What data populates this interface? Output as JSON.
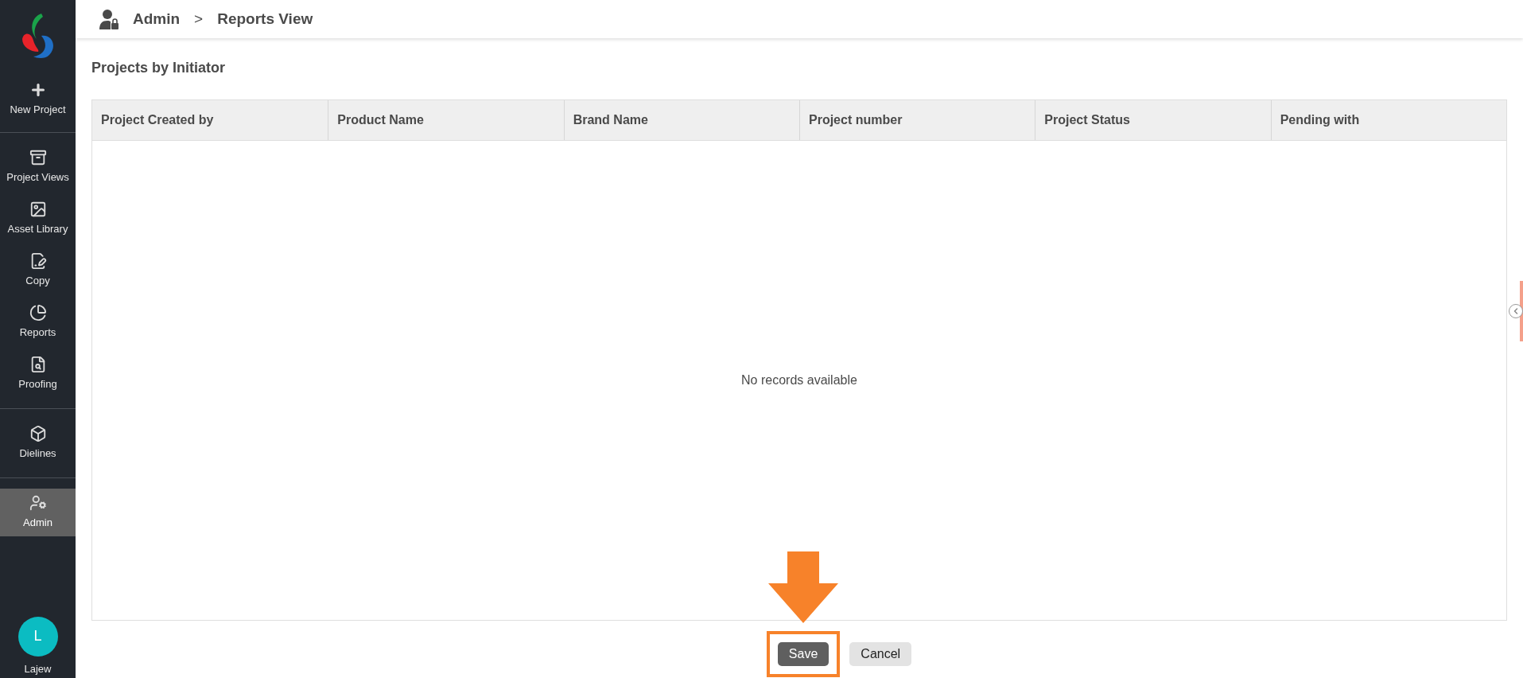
{
  "breadcrumb": {
    "section": "Admin",
    "separator": ">",
    "page": "Reports View"
  },
  "sidebar": {
    "groups": [
      [
        {
          "label": "New Project",
          "selected": false
        }
      ],
      [
        {
          "label": "Project Views",
          "selected": false
        },
        {
          "label": "Asset Library",
          "selected": false
        },
        {
          "label": "Copy",
          "selected": false
        },
        {
          "label": "Reports",
          "selected": false
        },
        {
          "label": "Proofing",
          "selected": false
        }
      ],
      [
        {
          "label": "Dielines",
          "selected": false
        }
      ],
      [
        {
          "label": "Admin",
          "selected": true
        }
      ]
    ],
    "user": {
      "initial": "L",
      "name": "Lajew",
      "color": "#0bbcc2"
    }
  },
  "report": {
    "title": "Projects by Initiator",
    "columns": [
      "Project Created by",
      "Product Name",
      "Brand Name",
      "Project number",
      "Project Status",
      "Pending with"
    ],
    "empty_message": "No records available"
  },
  "buttons": [
    {
      "label": "Save",
      "kind": "primary",
      "highlighted": true
    },
    {
      "label": "Cancel",
      "kind": "secondary",
      "highlighted": false
    }
  ]
}
